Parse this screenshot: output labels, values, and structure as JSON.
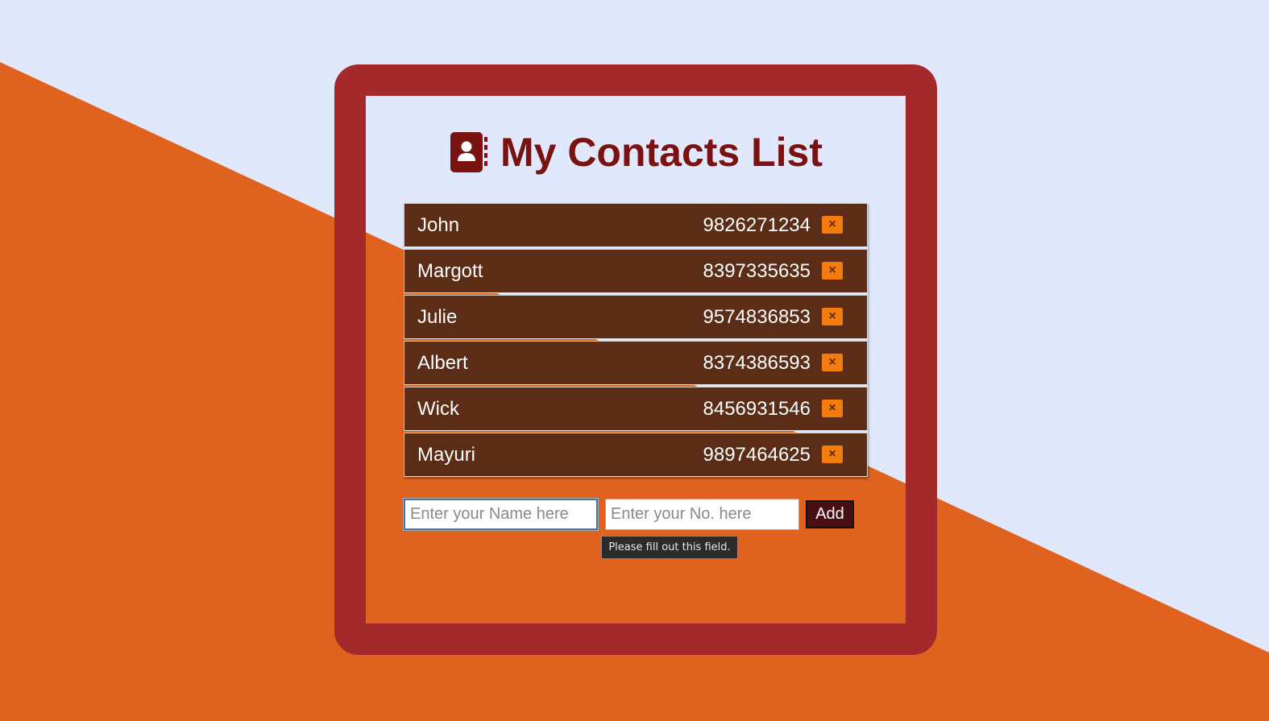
{
  "colors": {
    "page_background": "#e2e8fb",
    "stripe": "#df631e",
    "card_border": "#a4292b",
    "title": "#7a1212",
    "row_background": "#5b2d17",
    "delete_button": "#f47c0c",
    "add_button": "#4a0f12"
  },
  "header": {
    "icon": "address-book-icon",
    "title": "My Contacts List"
  },
  "contacts": [
    {
      "name": "John",
      "phone": "9826271234",
      "delete_label": "×"
    },
    {
      "name": "Margott",
      "phone": "8397335635",
      "delete_label": "×"
    },
    {
      "name": "Julie",
      "phone": "9574836853",
      "delete_label": "×"
    },
    {
      "name": "Albert",
      "phone": "8374386593",
      "delete_label": "×"
    },
    {
      "name": "Wick",
      "phone": "8456931546",
      "delete_label": "×"
    },
    {
      "name": "Mayuri",
      "phone": "9897464625",
      "delete_label": "×"
    }
  ],
  "form": {
    "name_value": "",
    "name_placeholder": "Enter your Name here",
    "number_value": "",
    "number_placeholder": "Enter your No. here",
    "add_label": "Add"
  },
  "validation_tooltip": "Please fill out this field."
}
